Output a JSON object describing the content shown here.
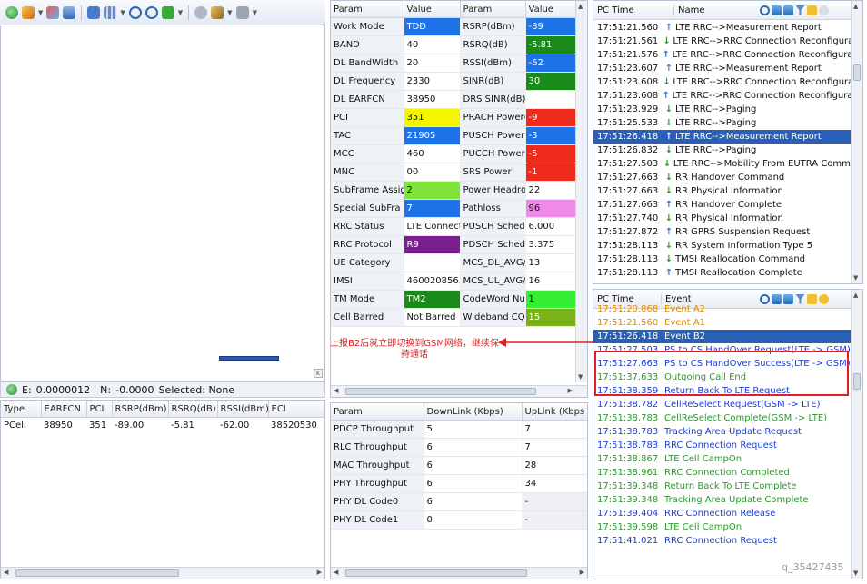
{
  "status_bar": {
    "e_label": "E:",
    "e_value": "0.0000012",
    "n_label": "N:",
    "n_value": "-0.0000",
    "selected": "Selected: None"
  },
  "param_table": {
    "headers": [
      "Param",
      "Value",
      "Param",
      "Value"
    ],
    "rows": [
      {
        "p1": "Work Mode",
        "v1": "TDD",
        "c1": "#1e73e8",
        "p2": "RSRP(dBm)",
        "v2": "-89",
        "c2": "#1e73e8"
      },
      {
        "p1": "BAND",
        "v1": "40",
        "c1": "",
        "p2": "RSRQ(dB)",
        "v2": "-5.81",
        "c2": "#1a8a1a"
      },
      {
        "p1": "DL BandWidth",
        "v1": "20",
        "c1": "",
        "p2": "RSSI(dBm)",
        "v2": "-62",
        "c2": "#1e73e8"
      },
      {
        "p1": "DL Frequency",
        "v1": "2330",
        "c1": "",
        "p2": "SINR(dB)",
        "v2": "30",
        "c2": "#1a8a1a"
      },
      {
        "p1": "DL EARFCN",
        "v1": "38950",
        "c1": "",
        "p2": "DRS SINR(dB)",
        "v2": "",
        "c2": ""
      },
      {
        "p1": "PCI",
        "v1": "351",
        "c1": "#f5f500",
        "p2": "PRACH Power(",
        "v2": "-9",
        "c2": "#ee2a1a"
      },
      {
        "p1": "TAC",
        "v1": "21905",
        "c1": "#1e73e8",
        "p2": "PUSCH Power",
        "v2": "-3",
        "c2": "#1e73e8"
      },
      {
        "p1": "MCC",
        "v1": "460",
        "c1": "",
        "p2": "PUCCH Power",
        "v2": "-5",
        "c2": "#ee2a1a"
      },
      {
        "p1": "MNC",
        "v1": "00",
        "c1": "",
        "p2": "SRS Power",
        "v2": "-1",
        "c2": "#ee2a1a"
      },
      {
        "p1": "SubFrame Assig",
        "v1": "2",
        "c1": "#7fe33a",
        "p2": "Power Headroo",
        "v2": "22",
        "c2": ""
      },
      {
        "p1": "Special SubFra",
        "v1": "7",
        "c1": "#1e73e8",
        "p2": "Pathloss",
        "v2": "96",
        "c2": "#f08ae8"
      },
      {
        "p1": "RRC Status",
        "v1": "LTE Connect",
        "c1": "",
        "p2": "PUSCH Schedul",
        "v2": "6.000",
        "c2": ""
      },
      {
        "p1": "RRC Protocol",
        "v1": "R9",
        "c1": "#7a1f8f",
        "p2": "PDSCH Schedul",
        "v2": "3.375",
        "c2": ""
      },
      {
        "p1": "UE Category",
        "v1": "",
        "c1": "",
        "p2": "MCS_DL_AVG/",
        "v2": "13",
        "c2": ""
      },
      {
        "p1": "IMSI",
        "v1": "4600208563",
        "c1": "",
        "p2": "MCS_UL_AVG/",
        "v2": "16",
        "c2": ""
      },
      {
        "p1": "TM Mode",
        "v1": "TM2",
        "c1": "#1a8a1a",
        "p2": "CodeWord Num",
        "v2": "1",
        "c2": "#33ee33"
      },
      {
        "p1": "Cell Barred",
        "v1": "Not Barred",
        "c1": "",
        "p2": "Wideband CQI",
        "v2": "15",
        "c2": "#7ab21a"
      }
    ]
  },
  "cell_table": {
    "headers": [
      "Type",
      "EARFCN",
      "PCI",
      "RSRP(dBm)",
      "RSRQ(dB)",
      "RSSI(dBm)",
      "ECI"
    ],
    "rows": [
      {
        "type": "PCell",
        "earfcn": "38950",
        "pci": "351",
        "rsrp": "-89.00",
        "rsrq": "-5.81",
        "rssi": "-62.00",
        "eci": "38520530"
      }
    ]
  },
  "throughput_table": {
    "headers": [
      "Param",
      "DownLink (Kbps)",
      "UpLink (Kbps"
    ],
    "rows": [
      {
        "p": "PDCP Throughput",
        "dl": "5",
        "ul": "7"
      },
      {
        "p": "RLC Throughput",
        "dl": "6",
        "ul": "7"
      },
      {
        "p": "MAC Throughput",
        "dl": "6",
        "ul": "28"
      },
      {
        "p": "PHY Throughput",
        "dl": "6",
        "ul": "34"
      },
      {
        "p": "PHY DL Code0",
        "dl": "6",
        "ul": "-"
      },
      {
        "p": "PHY DL Code1",
        "dl": "0",
        "ul": "-"
      }
    ]
  },
  "message_log": {
    "headers": [
      "PC Time",
      "Name"
    ],
    "rows": [
      {
        "t": "17:51:21.560",
        "dir": "up",
        "n": "LTE RRC-->Measurement Report",
        "sel": false
      },
      {
        "t": "17:51:21.561",
        "dir": "down",
        "n": "LTE RRC-->RRC Connection Reconfigurat",
        "sel": false
      },
      {
        "t": "17:51:21.576",
        "dir": "up",
        "n": "LTE RRC-->RRC Connection Reconfigurati",
        "sel": false
      },
      {
        "t": "17:51:23.607",
        "dir": "up",
        "n": "LTE RRC-->Measurement Report",
        "sel": false
      },
      {
        "t": "17:51:23.608",
        "dir": "down",
        "n": "LTE RRC-->RRC Connection Reconfigurat",
        "sel": false
      },
      {
        "t": "17:51:23.608",
        "dir": "up",
        "n": "LTE RRC-->RRC Connection Reconfigurati",
        "sel": false
      },
      {
        "t": "17:51:23.929",
        "dir": "down",
        "n": "LTE RRC-->Paging",
        "sel": false
      },
      {
        "t": "17:51:25.533",
        "dir": "down",
        "n": "LTE RRC-->Paging",
        "sel": false
      },
      {
        "t": "17:51:26.418",
        "dir": "up",
        "n": "LTE RRC-->Measurement Report",
        "sel": true
      },
      {
        "t": "17:51:26.832",
        "dir": "down",
        "n": "LTE RRC-->Paging",
        "sel": false
      },
      {
        "t": "17:51:27.503",
        "dir": "down",
        "n": "LTE RRC-->Mobility From EUTRA Comma",
        "sel": false
      },
      {
        "t": "17:51:27.663",
        "dir": "down",
        "n": "RR Handover Command",
        "sel": false
      },
      {
        "t": "17:51:27.663",
        "dir": "down",
        "n": "RR Physical Information",
        "sel": false
      },
      {
        "t": "17:51:27.663",
        "dir": "up",
        "n": "RR Handover Complete",
        "sel": false
      },
      {
        "t": "17:51:27.740",
        "dir": "down",
        "n": "RR Physical Information",
        "sel": false
      },
      {
        "t": "17:51:27.872",
        "dir": "up",
        "n": "RR GPRS Suspension Request",
        "sel": false
      },
      {
        "t": "17:51:28.113",
        "dir": "down",
        "n": "RR System Information Type 5",
        "sel": false
      },
      {
        "t": "17:51:28.113",
        "dir": "down",
        "n": "TMSI Reallocation Command",
        "sel": false
      },
      {
        "t": "17:51:28.113",
        "dir": "up",
        "n": "TMSI Reallocation Complete",
        "sel": false
      }
    ]
  },
  "event_log": {
    "headers": [
      "PC Time",
      "Event"
    ],
    "rows": [
      {
        "t": "17:51:20.868",
        "e": "Event A2",
        "color": "#e08a00",
        "sel": false
      },
      {
        "t": "17:51:21.560",
        "e": "Event A1",
        "color": "#e08a00",
        "sel": false
      },
      {
        "t": "17:51:26.418",
        "e": "Event B2",
        "color": "#ffffff",
        "sel": true
      },
      {
        "t": "17:51:27.503",
        "e": "PS to CS HandOver Request(LTE -> GSM)",
        "color": "#1a3fd8",
        "sel": false
      },
      {
        "t": "17:51:27.663",
        "e": "PS to CS HandOver Success(LTE -> GSM)",
        "color": "#1a3fd8",
        "sel": false
      },
      {
        "t": "17:51:37.633",
        "e": "Outgoing Call End",
        "color": "#2a9a2a",
        "sel": false
      },
      {
        "t": "17:51:38.359",
        "e": "Return Back To LTE Request",
        "color": "#1a3fd8",
        "sel": false
      },
      {
        "t": "17:51:38.782",
        "e": "CellReSelect Request(GSM -> LTE)",
        "color": "#1a3fd8",
        "sel": false
      },
      {
        "t": "17:51:38.783",
        "e": "CellReSelect Complete(GSM -> LTE)",
        "color": "#2a9a2a",
        "sel": false
      },
      {
        "t": "17:51:38.783",
        "e": "Tracking Area Update Request",
        "color": "#1a3fd8",
        "sel": false
      },
      {
        "t": "17:51:38.783",
        "e": "RRC Connection Request",
        "color": "#1a3fd8",
        "sel": false
      },
      {
        "t": "17:51:38.867",
        "e": "LTE Cell CampOn",
        "color": "#2a9a2a",
        "sel": false
      },
      {
        "t": "17:51:38.961",
        "e": "RRC Connection Completed",
        "color": "#2a9a2a",
        "sel": false
      },
      {
        "t": "17:51:39.348",
        "e": "Return Back To LTE Complete",
        "color": "#2a9a2a",
        "sel": false
      },
      {
        "t": "17:51:39.348",
        "e": "Tracking Area Update Complete",
        "color": "#2a9a2a",
        "sel": false
      },
      {
        "t": "17:51:39.404",
        "e": "RRC Connection Release",
        "color": "#1a3fd8",
        "sel": false
      },
      {
        "t": "17:51:39.598",
        "e": "LTE Cell CampOn",
        "color": "#2a9a2a",
        "sel": false
      },
      {
        "t": "17:51:41.021",
        "e": "RRC Connection Request",
        "color": "#1a3fd8",
        "sel": false
      }
    ]
  },
  "annotation": {
    "text": "上报B2后就立即切换到GSM网络，继续保持通话",
    "color": "#e02020"
  },
  "watermark": "q_35427435"
}
